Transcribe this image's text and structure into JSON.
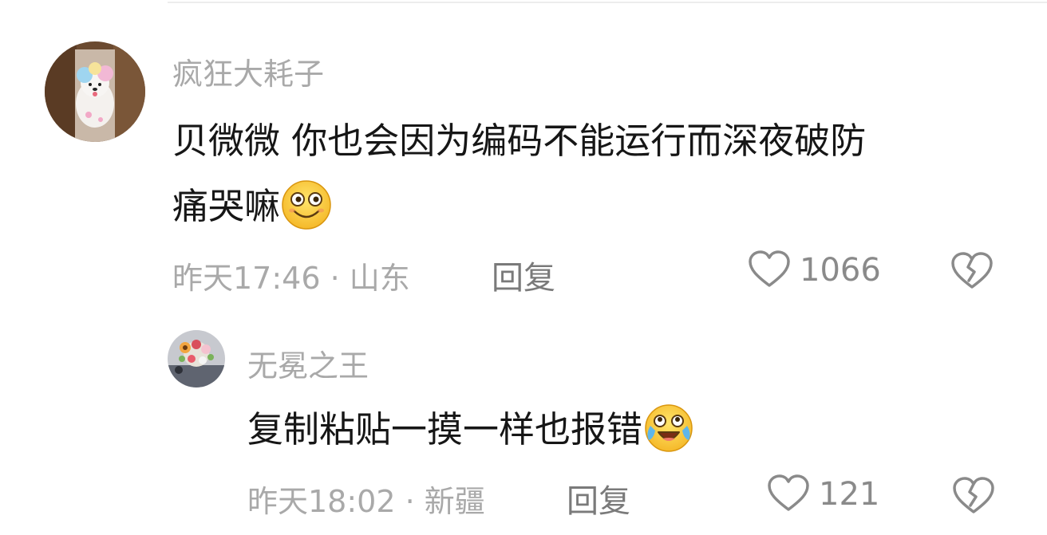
{
  "comments": [
    {
      "username": "疯狂大耗子",
      "text_line1": "贝微微 你也会因为编码不能运行而深夜破防",
      "text_line2": "痛哭嘛",
      "emoji": "dizzy-smile-emoji",
      "meta": "昨天17:46 · 山东",
      "reply_label": "回复",
      "likes": "1066",
      "avatar": "white-dog-avatar"
    },
    {
      "username": "无冕之王",
      "text_line1": "复制粘贴一摸一样也报错",
      "emoji": "tears-of-joy-emoji",
      "meta": "昨天18:02 · 新疆",
      "reply_label": "回复",
      "likes": "121",
      "avatar": "flower-bouquet-avatar"
    }
  ],
  "colors": {
    "username": "#a9a9a9",
    "text": "#161616",
    "meta": "#a9a9a9",
    "icon": "#8a8a8a"
  }
}
